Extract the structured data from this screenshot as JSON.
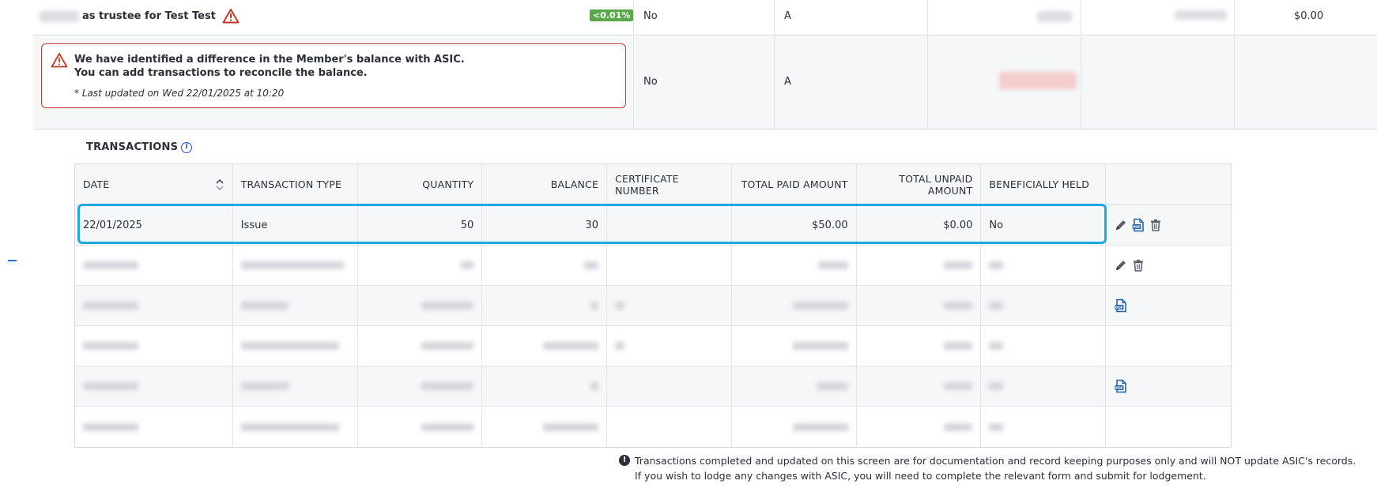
{
  "member_row": {
    "name_suffix": "as trustee for Test Test",
    "percent_badge": "<0.01%",
    "beneficial": "No",
    "class": "A",
    "amount": "$0.00"
  },
  "discrepancy_row": {
    "alert_line1": "We have identified a difference in the Member's balance with ASIC.",
    "alert_line2": "You can add transactions to reconcile the balance.",
    "alert_updated": "* Last updated on Wed 22/01/2025 at 10:20",
    "beneficial": "No",
    "class": "A"
  },
  "transactions": {
    "title": "TRANSACTIONS",
    "info_icon": "info-icon",
    "columns": {
      "date": "DATE",
      "type": "TRANSACTION TYPE",
      "quantity": "QUANTITY",
      "balance": "BALANCE",
      "certificate": "CERTIFICATE NUMBER",
      "paid": "TOTAL PAID AMOUNT",
      "unpaid": "TOTAL UNPAID AMOUNT",
      "beneficial": "BENEFICIALLY HELD"
    },
    "rows": [
      {
        "date": "22/01/2025",
        "type": "Issue",
        "quantity": "50",
        "balance": "30",
        "certificate": "",
        "paid": "$50.00",
        "unpaid": "$0.00",
        "beneficial": "No",
        "actions": [
          "pencil-icon",
          "pdf-icon",
          "trash-icon"
        ]
      }
    ]
  },
  "footnote": {
    "line1": "Transactions completed and updated on this screen are for documentation and record keeping purposes only and will NOT update ASIC's records.",
    "line2": "If you wish to lodge any changes with ASIC, you will need to complete the relevant form and submit for lodgement."
  },
  "colors": {
    "highlight": "#1ea7e1",
    "alert_border": "#c0392b",
    "badge_green": "#5aa84a",
    "icon_blue": "#1f5fa8"
  }
}
